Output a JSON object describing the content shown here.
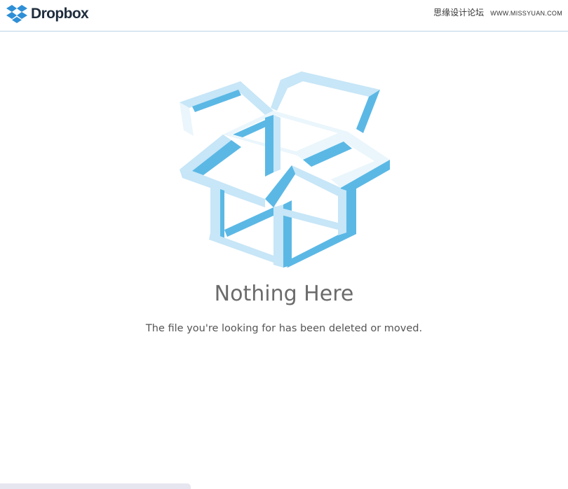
{
  "header": {
    "logo_text": "Dropbox",
    "watermark_cn": "思缘设计论坛",
    "watermark_url": "WWW.MISSYUAN.COM"
  },
  "icons": {
    "logo": "dropbox-logo-icon",
    "illustration": "open-box-illustration"
  },
  "main": {
    "title": "Nothing Here",
    "message": "The file you're looking for has been deleted or moved."
  },
  "colors": {
    "accent_blue": "#5bb8e5",
    "light_blue": "#c7e6f7",
    "pale_blue": "#eaf6fc",
    "header_border": "#b9d3e6",
    "title_gray": "#6b6b6b"
  }
}
